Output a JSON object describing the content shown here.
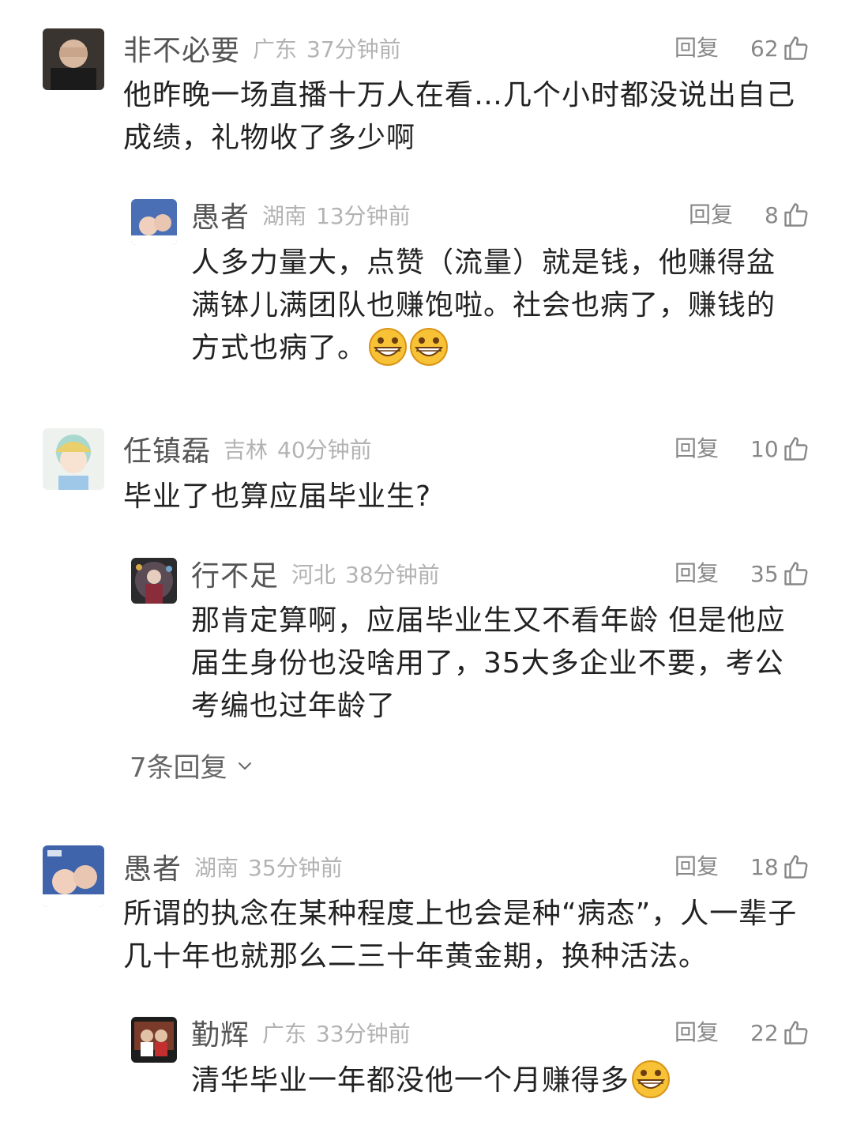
{
  "labels": {
    "reply": "回复"
  },
  "comments": [
    {
      "user": "非不必要",
      "location": "广东",
      "time": "37分钟前",
      "likes": "62",
      "text_lines": [
        "他昨晚一场直播十万人在看…几个小时都没说出自己",
        "成绩，礼物收了多少啊"
      ]
    },
    {
      "user": "愚者",
      "location": "湖南",
      "time": "13分钟前",
      "likes": "8",
      "text_lines": [
        "人多力量大，点赞（流量）就是钱，他赚得盆",
        "满钵儿满团队也赚饱啦。社会也病了，赚钱的",
        "方式也病了。"
      ]
    },
    {
      "user": "任镇磊",
      "location": "吉林",
      "time": "40分钟前",
      "likes": "10",
      "text_lines": [
        "毕业了也算应届毕业生?"
      ]
    },
    {
      "user": "行不足",
      "location": "河北",
      "time": "38分钟前",
      "likes": "35",
      "text_lines": [
        "那肯定算啊，应届毕业生又不看年龄 但是他应",
        "届生身份也没啥用了，35大多企业不要，考公",
        "考编也过年龄了"
      ]
    },
    {
      "user": "愚者",
      "location": "湖南",
      "time": "35分钟前",
      "likes": "18",
      "text_lines": [
        "所谓的执念在某种程度上也会是种“病态”，人一辈子",
        "几十年也就那么二三十年黄金期，换种活法。"
      ]
    },
    {
      "user": "勤辉",
      "location": "广东",
      "time": "33分钟前",
      "likes": "22",
      "text_lines": [
        "清华毕业一年都没他一个月赚得多"
      ]
    }
  ],
  "more_replies": "7条回复",
  "icons": {
    "like": "thumbs-up-icon",
    "emoji": "grinning-face-icon",
    "expand": "chevron-down-icon"
  }
}
